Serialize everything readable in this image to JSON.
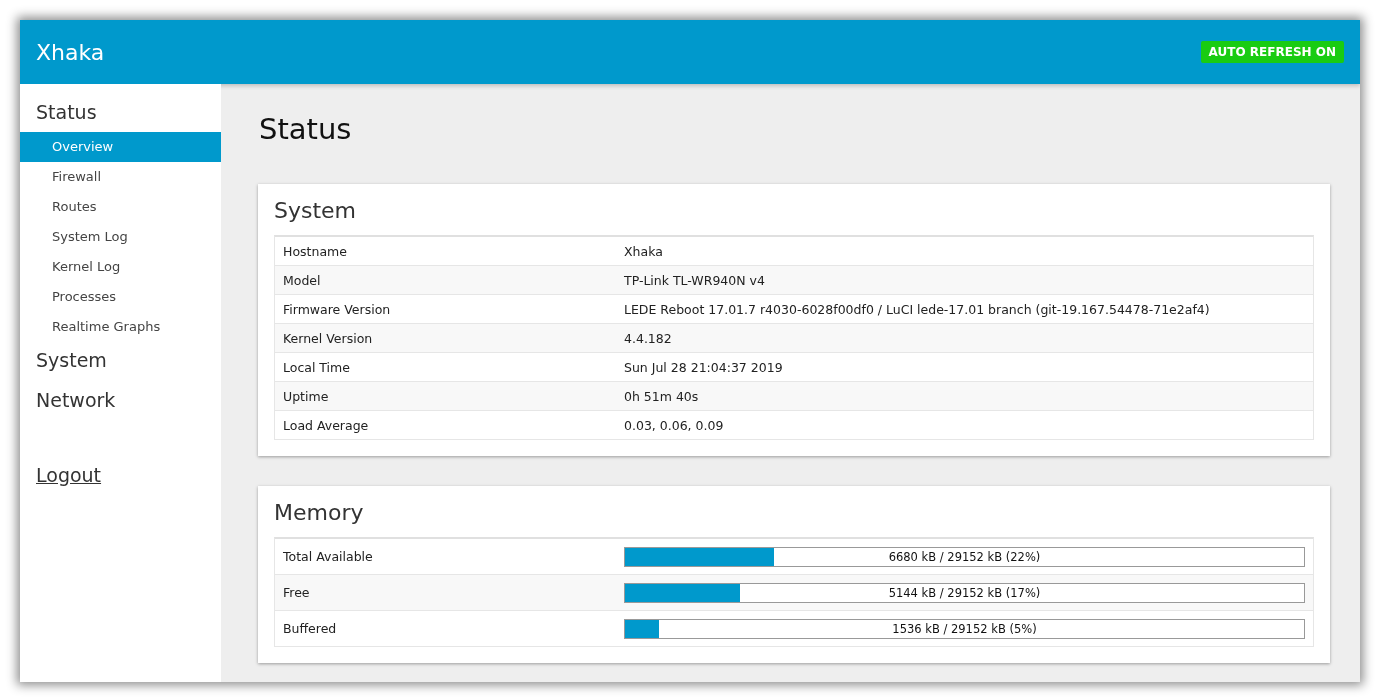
{
  "header": {
    "brand": "Xhaka",
    "auto_refresh": {
      "label": "AUTO REFRESH ON",
      "on": true
    }
  },
  "sidebar": {
    "sections": [
      {
        "label": "Status",
        "items": [
          {
            "label": "Overview",
            "selected": true
          },
          {
            "label": "Firewall",
            "selected": false
          },
          {
            "label": "Routes",
            "selected": false
          },
          {
            "label": "System Log",
            "selected": false
          },
          {
            "label": "Kernel Log",
            "selected": false
          },
          {
            "label": "Processes",
            "selected": false
          },
          {
            "label": "Realtime Graphs",
            "selected": false
          }
        ]
      },
      {
        "label": "System"
      },
      {
        "label": "Network"
      }
    ],
    "logout": "Logout"
  },
  "page_title": "Status",
  "system": {
    "title": "System",
    "rows": [
      {
        "label": "Hostname",
        "value": "Xhaka"
      },
      {
        "label": "Model",
        "value": "TP-Link TL-WR940N v4"
      },
      {
        "label": "Firmware Version",
        "value": "LEDE Reboot 17.01.7 r4030-6028f00df0 / LuCI lede-17.01 branch (git-19.167.54478-71e2af4)"
      },
      {
        "label": "Kernel Version",
        "value": "4.4.182"
      },
      {
        "label": "Local Time",
        "value": "Sun Jul 28 21:04:37 2019"
      },
      {
        "label": "Uptime",
        "value": "0h 51m 40s"
      },
      {
        "label": "Load Average",
        "value": "0.03, 0.06, 0.09"
      }
    ]
  },
  "memory": {
    "title": "Memory",
    "rows": [
      {
        "label": "Total Available",
        "level": 0.22,
        "reading": "6680 kB / 29152 kB (22%)"
      },
      {
        "label": "Free",
        "level": 0.17,
        "reading": "5144 kB / 29152 kB (17%)"
      },
      {
        "label": "Buffered",
        "level": 0.05,
        "reading": "1536 kB / 29152 kB (5%)"
      }
    ]
  }
}
